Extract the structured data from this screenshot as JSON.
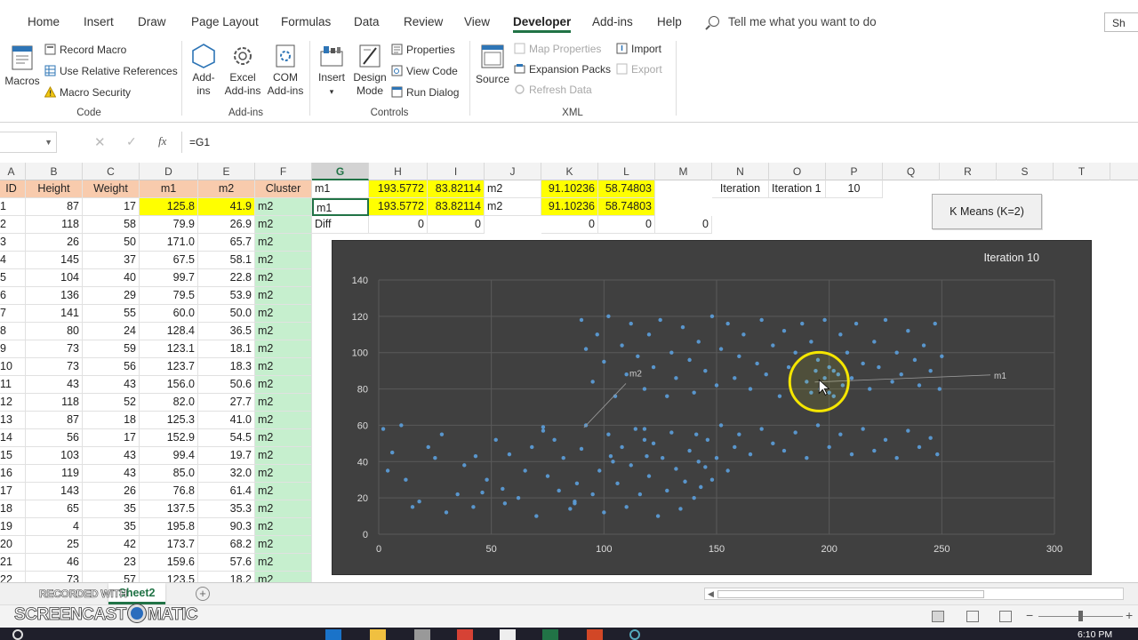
{
  "ribbon": {
    "tabs": [
      "Home",
      "Insert",
      "Draw",
      "Page Layout",
      "Formulas",
      "Data",
      "Review",
      "View",
      "Developer",
      "Add-ins",
      "Help"
    ],
    "active_tab": "Developer",
    "tell_me": "Tell me what you want to do",
    "share": "Sh",
    "groups": {
      "code": {
        "label": "Code",
        "macros": "Macros",
        "record_macro": "Record Macro",
        "use_relative": "Use Relative References",
        "macro_security": "Macro Security"
      },
      "addins": {
        "label": "Add-ins",
        "addins_1": "Add-",
        "addins_2": "ins",
        "excel_1": "Excel",
        "excel_2": "Add-ins",
        "com_1": "COM",
        "com_2": "Add-ins"
      },
      "controls": {
        "label": "Controls",
        "insert": "Insert",
        "design_1": "Design",
        "design_2": "Mode",
        "properties": "Properties",
        "view_code": "View Code",
        "run_dialog": "Run Dialog"
      },
      "xml": {
        "label": "XML",
        "source": "Source",
        "map_properties": "Map Properties",
        "expansion_packs": "Expansion Packs",
        "refresh_data": "Refresh Data",
        "import": "Import",
        "export": "Export"
      }
    }
  },
  "formula_bar": {
    "name_box": "",
    "formula": "=G1"
  },
  "columns": [
    "A",
    "B",
    "C",
    "D",
    "E",
    "F",
    "G",
    "H",
    "I",
    "J",
    "K",
    "L",
    "M",
    "N",
    "O",
    "P",
    "Q",
    "R",
    "S",
    "T"
  ],
  "selected_column": "G",
  "header_row": {
    "id": "ID",
    "height": "Height",
    "weight": "Weight",
    "m1": "m1",
    "m2": "m2",
    "cluster": "Cluster"
  },
  "data_rows": [
    {
      "id": "1",
      "height": "87",
      "weight": "17",
      "m1": "125.8",
      "m2": "41.9",
      "cluster": "m2"
    },
    {
      "id": "2",
      "height": "118",
      "weight": "58",
      "m1": "79.9",
      "m2": "26.9",
      "cluster": "m2"
    },
    {
      "id": "3",
      "height": "26",
      "weight": "50",
      "m1": "171.0",
      "m2": "65.7",
      "cluster": "m2"
    },
    {
      "id": "4",
      "height": "145",
      "weight": "37",
      "m1": "67.5",
      "m2": "58.1",
      "cluster": "m2"
    },
    {
      "id": "5",
      "height": "104",
      "weight": "40",
      "m1": "99.7",
      "m2": "22.8",
      "cluster": "m2"
    },
    {
      "id": "6",
      "height": "136",
      "weight": "29",
      "m1": "79.5",
      "m2": "53.9",
      "cluster": "m2"
    },
    {
      "id": "7",
      "height": "141",
      "weight": "55",
      "m1": "60.0",
      "m2": "50.0",
      "cluster": "m2"
    },
    {
      "id": "8",
      "height": "80",
      "weight": "24",
      "m1": "128.4",
      "m2": "36.5",
      "cluster": "m2"
    },
    {
      "id": "9",
      "height": "73",
      "weight": "59",
      "m1": "123.1",
      "m2": "18.1",
      "cluster": "m2"
    },
    {
      "id": "10",
      "height": "73",
      "weight": "56",
      "m1": "123.7",
      "m2": "18.3",
      "cluster": "m2"
    },
    {
      "id": "11",
      "height": "43",
      "weight": "43",
      "m1": "156.0",
      "m2": "50.6",
      "cluster": "m2"
    },
    {
      "id": "12",
      "height": "118",
      "weight": "52",
      "m1": "82.0",
      "m2": "27.7",
      "cluster": "m2"
    },
    {
      "id": "13",
      "height": "87",
      "weight": "18",
      "m1": "125.3",
      "m2": "41.0",
      "cluster": "m2"
    },
    {
      "id": "14",
      "height": "56",
      "weight": "17",
      "m1": "152.9",
      "m2": "54.5",
      "cluster": "m2"
    },
    {
      "id": "15",
      "height": "103",
      "weight": "43",
      "m1": "99.4",
      "m2": "19.7",
      "cluster": "m2"
    },
    {
      "id": "16",
      "height": "119",
      "weight": "43",
      "m1": "85.0",
      "m2": "32.0",
      "cluster": "m2"
    },
    {
      "id": "17",
      "height": "143",
      "weight": "26",
      "m1": "76.8",
      "m2": "61.4",
      "cluster": "m2"
    },
    {
      "id": "18",
      "height": "65",
      "weight": "35",
      "m1": "137.5",
      "m2": "35.3",
      "cluster": "m2"
    },
    {
      "id": "19",
      "height": "4",
      "weight": "35",
      "m1": "195.8",
      "m2": "90.3",
      "cluster": "m2"
    },
    {
      "id": "20",
      "height": "25",
      "weight": "42",
      "m1": "173.7",
      "m2": "68.2",
      "cluster": "m2"
    },
    {
      "id": "21",
      "height": "46",
      "weight": "23",
      "m1": "159.6",
      "m2": "57.6",
      "cluster": "m2"
    },
    {
      "id": "22",
      "height": "73",
      "weight": "57",
      "m1": "123.5",
      "m2": "18.2",
      "cluster": "m2"
    }
  ],
  "centroids": {
    "row1": {
      "g": "m1",
      "h": "193.5772",
      "i": "83.82114",
      "j": "m2",
      "k": "91.10236",
      "l": "58.74803"
    },
    "row2": {
      "g": "m1",
      "h": "193.5772",
      "i": "83.82114",
      "j": "m2",
      "k": "91.10236",
      "l": "58.74803"
    },
    "diff": {
      "g": "Diff",
      "h": "0",
      "i": "0",
      "k": "0",
      "l": "0",
      "m": "0"
    }
  },
  "iteration": {
    "n": "Iteration",
    "o": "Iteration 1",
    "p": "10"
  },
  "kmeans_button": "K Means (K=2)",
  "chart_data": {
    "type": "scatter",
    "title": "Iteration 10",
    "xlabel": "",
    "ylabel": "",
    "xlim": [
      0,
      300
    ],
    "ylim": [
      0,
      140
    ],
    "x_ticks": [
      "0",
      "50",
      "100",
      "150",
      "200",
      "250",
      "300"
    ],
    "y_ticks": [
      "0",
      "20",
      "40",
      "60",
      "80",
      "100",
      "120",
      "140"
    ],
    "grid": true,
    "marker_color": "#5b9bd5",
    "background": "#404040",
    "annotations": [
      {
        "label": "m1",
        "x": 193.6,
        "y": 83.8
      },
      {
        "label": "m2",
        "x": 91.1,
        "y": 58.7
      }
    ],
    "series": [
      {
        "values": [
          [
            4,
            35
          ],
          [
            25,
            42
          ],
          [
            43,
            43
          ],
          [
            46,
            23
          ],
          [
            56,
            17
          ],
          [
            65,
            35
          ],
          [
            73,
            57
          ],
          [
            73,
            59
          ],
          [
            80,
            24
          ],
          [
            87,
            17
          ],
          [
            87,
            18
          ],
          [
            103,
            43
          ],
          [
            104,
            40
          ],
          [
            118,
            52
          ],
          [
            118,
            58
          ],
          [
            119,
            43
          ],
          [
            136,
            29
          ],
          [
            141,
            55
          ],
          [
            143,
            26
          ],
          [
            145,
            37
          ],
          [
            2,
            58
          ],
          [
            6,
            45
          ],
          [
            10,
            60
          ],
          [
            12,
            30
          ],
          [
            15,
            15
          ],
          [
            18,
            18
          ],
          [
            22,
            48
          ],
          [
            28,
            55
          ],
          [
            30,
            12
          ],
          [
            35,
            22
          ],
          [
            38,
            38
          ],
          [
            42,
            15
          ],
          [
            48,
            30
          ],
          [
            52,
            52
          ],
          [
            55,
            25
          ],
          [
            58,
            44
          ],
          [
            62,
            20
          ],
          [
            68,
            48
          ],
          [
            70,
            10
          ],
          [
            75,
            32
          ],
          [
            78,
            52
          ],
          [
            82,
            42
          ],
          [
            85,
            14
          ],
          [
            88,
            28
          ],
          [
            90,
            47
          ],
          [
            92,
            60
          ],
          [
            95,
            22
          ],
          [
            98,
            35
          ],
          [
            100,
            12
          ],
          [
            102,
            55
          ],
          [
            106,
            28
          ],
          [
            108,
            48
          ],
          [
            110,
            15
          ],
          [
            112,
            38
          ],
          [
            114,
            58
          ],
          [
            116,
            22
          ],
          [
            120,
            32
          ],
          [
            122,
            50
          ],
          [
            124,
            10
          ],
          [
            126,
            42
          ],
          [
            128,
            24
          ],
          [
            130,
            56
          ],
          [
            132,
            36
          ],
          [
            134,
            14
          ],
          [
            138,
            46
          ],
          [
            140,
            20
          ],
          [
            142,
            40
          ],
          [
            146,
            52
          ],
          [
            148,
            30
          ],
          [
            150,
            42
          ],
          [
            152,
            60
          ],
          [
            155,
            35
          ],
          [
            158,
            48
          ],
          [
            160,
            55
          ],
          [
            165,
            44
          ],
          [
            170,
            58
          ],
          [
            175,
            50
          ],
          [
            180,
            46
          ],
          [
            185,
            56
          ],
          [
            190,
            42
          ],
          [
            195,
            60
          ],
          [
            200,
            48
          ],
          [
            205,
            55
          ],
          [
            210,
            44
          ],
          [
            215,
            58
          ],
          [
            220,
            46
          ],
          [
            225,
            52
          ],
          [
            230,
            42
          ],
          [
            235,
            57
          ],
          [
            240,
            48
          ],
          [
            245,
            53
          ],
          [
            248,
            44
          ],
          [
            90,
            118
          ],
          [
            92,
            102
          ],
          [
            95,
            84
          ],
          [
            97,
            110
          ],
          [
            100,
            95
          ],
          [
            102,
            120
          ],
          [
            105,
            76
          ],
          [
            108,
            104
          ],
          [
            110,
            88
          ],
          [
            112,
            116
          ],
          [
            115,
            98
          ],
          [
            118,
            80
          ],
          [
            120,
            110
          ],
          [
            122,
            92
          ],
          [
            125,
            118
          ],
          [
            128,
            76
          ],
          [
            130,
            100
          ],
          [
            132,
            86
          ],
          [
            135,
            114
          ],
          [
            138,
            96
          ],
          [
            140,
            78
          ],
          [
            142,
            106
          ],
          [
            145,
            90
          ],
          [
            148,
            120
          ],
          [
            150,
            82
          ],
          [
            152,
            102
          ],
          [
            155,
            116
          ],
          [
            158,
            86
          ],
          [
            160,
            98
          ],
          [
            162,
            110
          ],
          [
            165,
            80
          ],
          [
            168,
            94
          ],
          [
            170,
            118
          ],
          [
            172,
            88
          ],
          [
            175,
            104
          ],
          [
            178,
            76
          ],
          [
            180,
            112
          ],
          [
            182,
            92
          ],
          [
            185,
            100
          ],
          [
            188,
            116
          ],
          [
            190,
            84
          ],
          [
            192,
            106
          ],
          [
            195,
            96
          ],
          [
            198,
            118
          ],
          [
            200,
            78
          ],
          [
            202,
            90
          ],
          [
            205,
            110
          ],
          [
            208,
            100
          ],
          [
            210,
            86
          ],
          [
            212,
            116
          ],
          [
            215,
            94
          ],
          [
            218,
            80
          ],
          [
            220,
            106
          ],
          [
            222,
            92
          ],
          [
            225,
            118
          ],
          [
            228,
            84
          ],
          [
            230,
            100
          ],
          [
            232,
            88
          ],
          [
            235,
            112
          ],
          [
            238,
            96
          ],
          [
            240,
            82
          ],
          [
            242,
            104
          ],
          [
            245,
            90
          ],
          [
            247,
            116
          ],
          [
            249,
            80
          ],
          [
            250,
            98
          ],
          [
            196,
            80
          ],
          [
            198,
            86
          ],
          [
            200,
            92
          ],
          [
            202,
            76
          ],
          [
            204,
            88
          ],
          [
            194,
            90
          ],
          [
            192,
            78
          ],
          [
            206,
            82
          ]
        ]
      }
    ]
  },
  "sheet_tab": "Sheet2",
  "add_sheet": "+",
  "status": {
    "clock": "6:10 PM"
  },
  "watermark": {
    "line1": "RECORDED WITH",
    "line2a": "SCREENCAST",
    "line2b": "MATIC"
  }
}
